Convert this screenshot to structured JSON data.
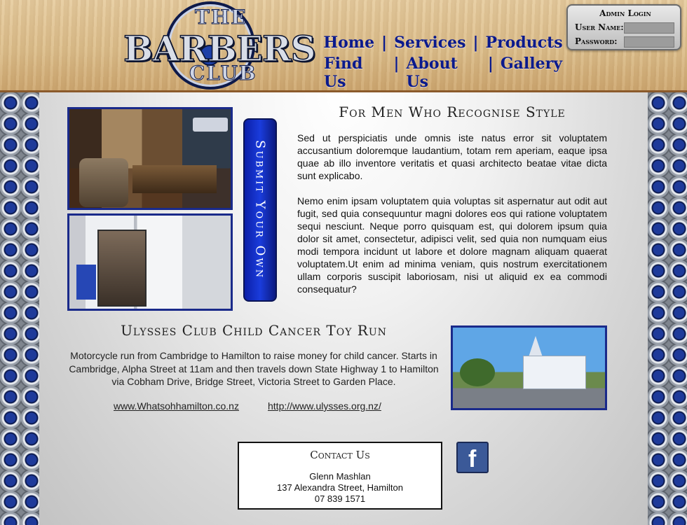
{
  "logo": {
    "top_word": "THE",
    "main_word": "BARBERS",
    "bottom_word": "CLUB"
  },
  "nav": {
    "items": [
      "Home",
      "Services",
      "Products",
      "Find Us",
      "About Us",
      "Gallery"
    ],
    "separator": "|"
  },
  "admin": {
    "title": "Admin Login",
    "username_label": "User Name:",
    "password_label": "Password:",
    "username_value": "",
    "password_value": ""
  },
  "submit_tab": {
    "label": "Submit Your Own"
  },
  "style_section": {
    "heading": "For Men Who Recognise Style",
    "paragraph_1": "Sed ut perspiciatis unde omnis iste natus error sit voluptatem accusantium doloremque laudantium, totam rem aperiam, eaque ipsa quae ab illo inventore veritatis et quasi architecto beatae vitae dicta sunt explicabo.",
    "paragraph_2": "Nemo enim ipsam voluptatem quia voluptas sit aspernatur aut odit aut fugit, sed quia consequuntur magni dolores eos qui ratione voluptatem sequi nesciunt. Neque porro quisquam est, qui dolorem ipsum quia dolor sit amet, consectetur, adipisci velit, sed quia non numquam eius modi tempora incidunt ut labore et dolore magnam aliquam quaerat voluptatem.Ut enim ad minima veniam, quis nostrum exercitationem ullam corporis suscipit laboriosam, nisi ut aliquid ex ea commodi consequatur?"
  },
  "toy_run": {
    "heading": "Ulysses Club Child Cancer Toy Run",
    "text": "Motorcycle run from Cambridge to Hamilton to raise money for child cancer. Starts in Cambridge, Alpha Street at 11am and then travels down State Highway 1 to Hamilton via Cobham Drive, Bridge Street, Victoria Street to Garden Place.",
    "link_1": "www.Whatsohhamilton.co.nz",
    "link_2": "http://www.ulysses.org.nz/"
  },
  "contact": {
    "title": "Contact Us",
    "name": "Glenn Mashlan",
    "address": "137 Alexandra Street, Hamilton",
    "phone": "07 839 1571"
  },
  "colors": {
    "nav_blue": "#0b1a8c",
    "accent_blue": "#1a2a8a",
    "facebook_blue": "#3b5998"
  }
}
